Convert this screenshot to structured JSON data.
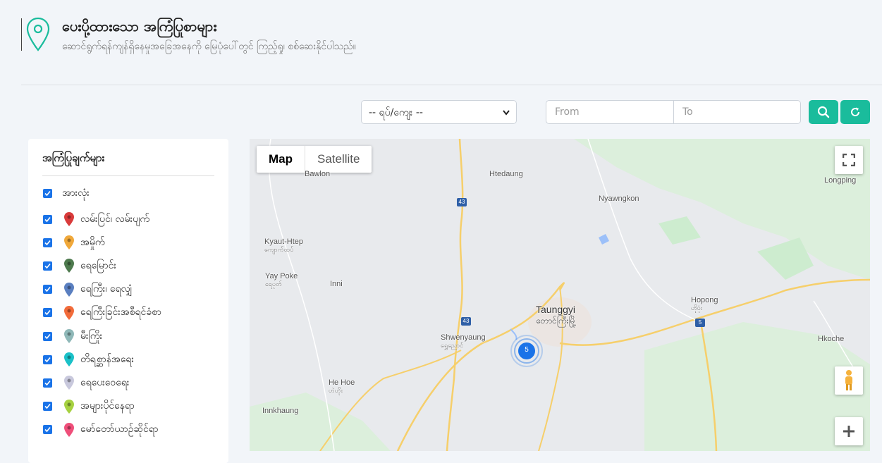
{
  "header": {
    "title": "ပေးပို့ထားသော အကြံပြုစာများ",
    "subtitle": "ဆောင်ရွက်ရန်ကျန်ရှိနေမှုအခြေအနေကို မြေပုံပေါ်တွင် ကြည့်ရှု၊ စစ်ဆေးနိုင်ပါသည်။"
  },
  "filters": {
    "township_select": "-- ရပ်/ကျေး --",
    "from_placeholder": "From",
    "to_placeholder": "To"
  },
  "legend": {
    "title": "အကြံပြုချက်များ",
    "all_label": "အားလုံး",
    "items": [
      {
        "label": "လမ်းပြင်၊ လမ်းပျက်",
        "color": "#d93b3b"
      },
      {
        "label": "အမှိုက်",
        "color": "#f0a83a"
      },
      {
        "label": "ရေမြောင်း",
        "color": "#4e7a4e"
      },
      {
        "label": "ရေကြီး၊ ရေလျှံ",
        "color": "#5a7fc0"
      },
      {
        "label": "ရေကြီးခြင်းအစီရင်ခံစာ",
        "color": "#f26b3a"
      },
      {
        "label": "မီးကြိုး",
        "color": "#8fb8b8"
      },
      {
        "label": "တိရစ္ဆာန်အရေး",
        "color": "#1bc1c8"
      },
      {
        "label": "ရေပေးဝေရေး",
        "color": "#c8c8dc"
      },
      {
        "label": "အများပိုင်နေရာ",
        "color": "#a6d140"
      },
      {
        "label": "မော်တော်ယာဉ်ဆိုင်ရာ",
        "color": "#ef4f7a"
      }
    ]
  },
  "map": {
    "type_map": "Map",
    "type_satellite": "Satellite",
    "cluster_count": "5",
    "places": {
      "bawlon": "Bawlon",
      "htedaung": "Htedaung",
      "longping": "Longping",
      "nyawngkon": "Nyawngkon",
      "kyaut_htep": "Kyaut-Htep",
      "kyaut_htep_mm": "ကျောက်ထပ်",
      "yay_poke": "Yay Poke",
      "yay_poke_mm": "ရေပုတ်",
      "inni": "Inni",
      "taunggyi": "Taunggyi",
      "taunggyi_mm": "တောင်ကြီးမြို့",
      "hopong": "Hopong",
      "hopong_mm": "ဟိုပုံး",
      "shwenyaung": "Shwenyaung",
      "shwenyaung_mm": "ရွှေညောင်",
      "hkoche": "Hkoche",
      "he_hoe": "He Hoe",
      "he_hoe_mm": "ဟဲဟိုး",
      "innkhaung": "Innkhaung"
    },
    "routes": {
      "r43a": "43",
      "r43b": "43",
      "r5": "5"
    }
  },
  "colors": {
    "accent": "#1abc9c",
    "checkbox": "#1a73e8",
    "cluster": "#1a73e8"
  }
}
